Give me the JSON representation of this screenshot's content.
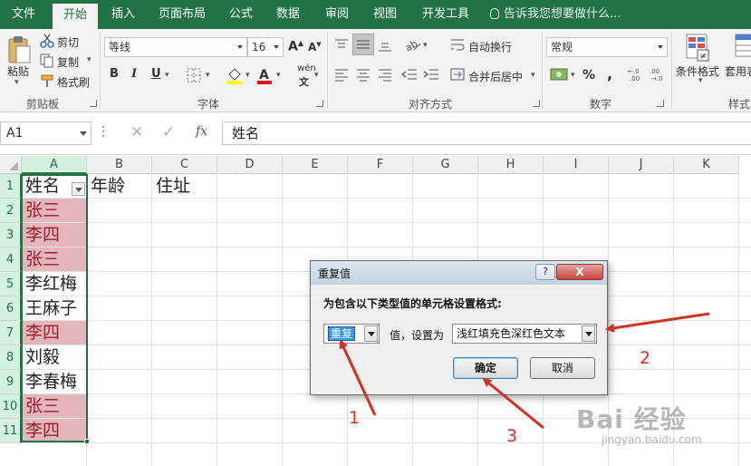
{
  "ribbon_tabs": [
    "文件",
    "开始",
    "插入",
    "页面布局",
    "公式",
    "数据",
    "审阅",
    "视图",
    "开发工具"
  ],
  "tell_me": "告诉我您想要做什么...",
  "clipboard": {
    "paste": "粘贴",
    "cut": "剪切",
    "copy": "复制",
    "format_painter": "格式刷",
    "group": "剪贴板"
  },
  "font": {
    "name": "等线",
    "size": "16",
    "group": "字体",
    "bold": "B",
    "italic": "I",
    "underline": "U",
    "wen": "wén"
  },
  "alignment": {
    "wrap": "自动换行",
    "merge": "合并后居中",
    "group": "对齐方式"
  },
  "number": {
    "format": "常规",
    "percent": "%",
    "comma": ",",
    "group": "数字"
  },
  "styles": {
    "conditional": "条件格式",
    "table": "套用表格格式",
    "group": "样式"
  },
  "formula_bar": {
    "name_box": "A1",
    "fx": "fx",
    "value": "姓名"
  },
  "columns": [
    "A",
    "B",
    "C",
    "D",
    "E",
    "F",
    "G",
    "H",
    "I",
    "J",
    "K"
  ],
  "rows": [
    "1",
    "2",
    "3",
    "4",
    "5",
    "6",
    "7",
    "8",
    "9",
    "10",
    "11"
  ],
  "headers": {
    "a1": "姓名",
    "b1": "年龄",
    "c1": "住址"
  },
  "names": [
    {
      "text": "张三",
      "dup": true
    },
    {
      "text": "李四",
      "dup": true
    },
    {
      "text": "张三",
      "dup": true
    },
    {
      "text": "李红梅",
      "dup": false
    },
    {
      "text": "王麻子",
      "dup": false
    },
    {
      "text": "李四",
      "dup": true
    },
    {
      "text": "刘毅",
      "dup": false
    },
    {
      "text": "李春梅",
      "dup": false
    },
    {
      "text": "张三",
      "dup": true
    },
    {
      "text": "李四",
      "dup": true
    }
  ],
  "colors": {
    "excel_green": "#217346",
    "dup_fill": "#e4b7bd",
    "dup_text": "#9c1f2b",
    "annotation": "#d43020"
  },
  "dialog": {
    "title": "重复值",
    "help": "?",
    "close": "X",
    "prompt": "为包含以下类型值的单元格设置格式:",
    "type_value": "重复",
    "label": "值，设置为",
    "format_value": "浅红填充色深红色文本",
    "ok": "确定",
    "cancel": "取消"
  },
  "annotations": [
    "1",
    "2",
    "3"
  ],
  "watermark": {
    "brand": "Bai 经验",
    "url": "jingyan.baidu.com"
  }
}
